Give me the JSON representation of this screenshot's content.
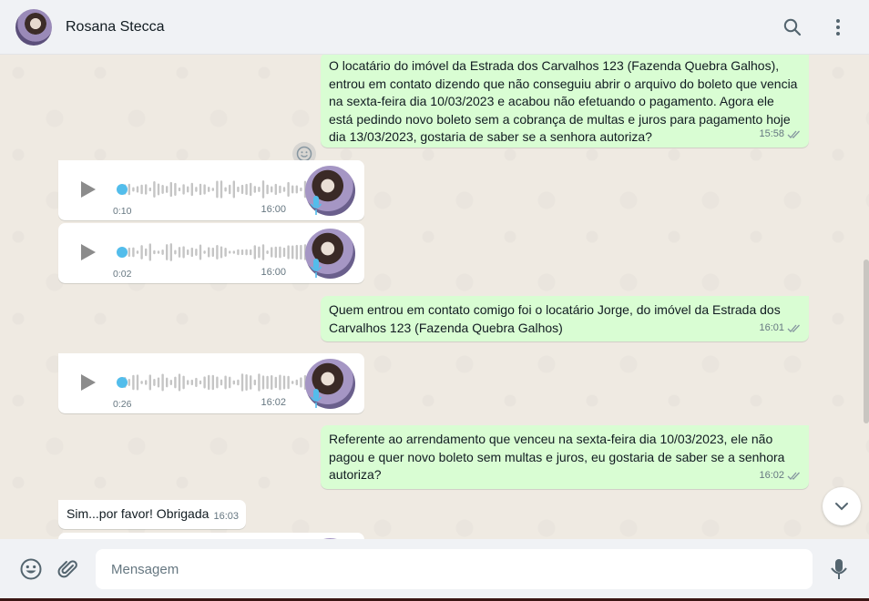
{
  "header": {
    "contact_name": "Rosana Stecca",
    "icons": [
      "search-icon",
      "menu-dots-icon"
    ]
  },
  "messages": [
    {
      "type": "text",
      "direction": "out",
      "text": "O locatário do imóvel da Estrada dos Carvalhos 123 (Fazenda Quebra Galhos), entrou em contato dizendo que não conseguiu abrir o arquivo do boleto que vencia na sexta-feira dia 10/03/2023 e acabou não efetuando o pagamento. Agora ele está pedindo novo boleto sem a cobrança de multas e juros para pagamento hoje dia 13/03/2023, gostaria de saber se a senhora autoriza?",
      "time": "15:58",
      "status": "read"
    },
    {
      "type": "audio",
      "direction": "in",
      "duration": "0:10",
      "time": "16:00"
    },
    {
      "type": "audio",
      "direction": "in",
      "duration": "0:02",
      "time": "16:00"
    },
    {
      "type": "text",
      "direction": "out",
      "text": "Quem entrou em contato comigo foi o locatário Jorge, do imóvel da Estrada dos Carvalhos 123 (Fazenda Quebra Galhos)",
      "time": "16:01",
      "status": "read"
    },
    {
      "type": "audio",
      "direction": "in",
      "duration": "0:26",
      "time": "16:02"
    },
    {
      "type": "text",
      "direction": "out",
      "text": "Referente ao arrendamento que venceu na sexta-feira dia 10/03/2023, ele não pagou e quer novo boleto sem multas e juros, eu gostaria de saber se a senhora autoriza?",
      "time": "16:02",
      "status": "read"
    },
    {
      "type": "text",
      "direction": "in",
      "text": "Sim...por favor! Obrigada",
      "time": "16:03"
    }
  ],
  "composer": {
    "placeholder": "Mensagem",
    "icons": [
      "emoji-icon",
      "attach-icon",
      "microphone-icon"
    ]
  },
  "colors": {
    "outgoing_bubble": "#d9fdd3",
    "incoming_bubble": "#ffffff",
    "chat_background": "#efeae2",
    "header_background": "#f0f2f5",
    "audio_accent": "#53bdeb",
    "read_ticks": "#8696a0"
  }
}
